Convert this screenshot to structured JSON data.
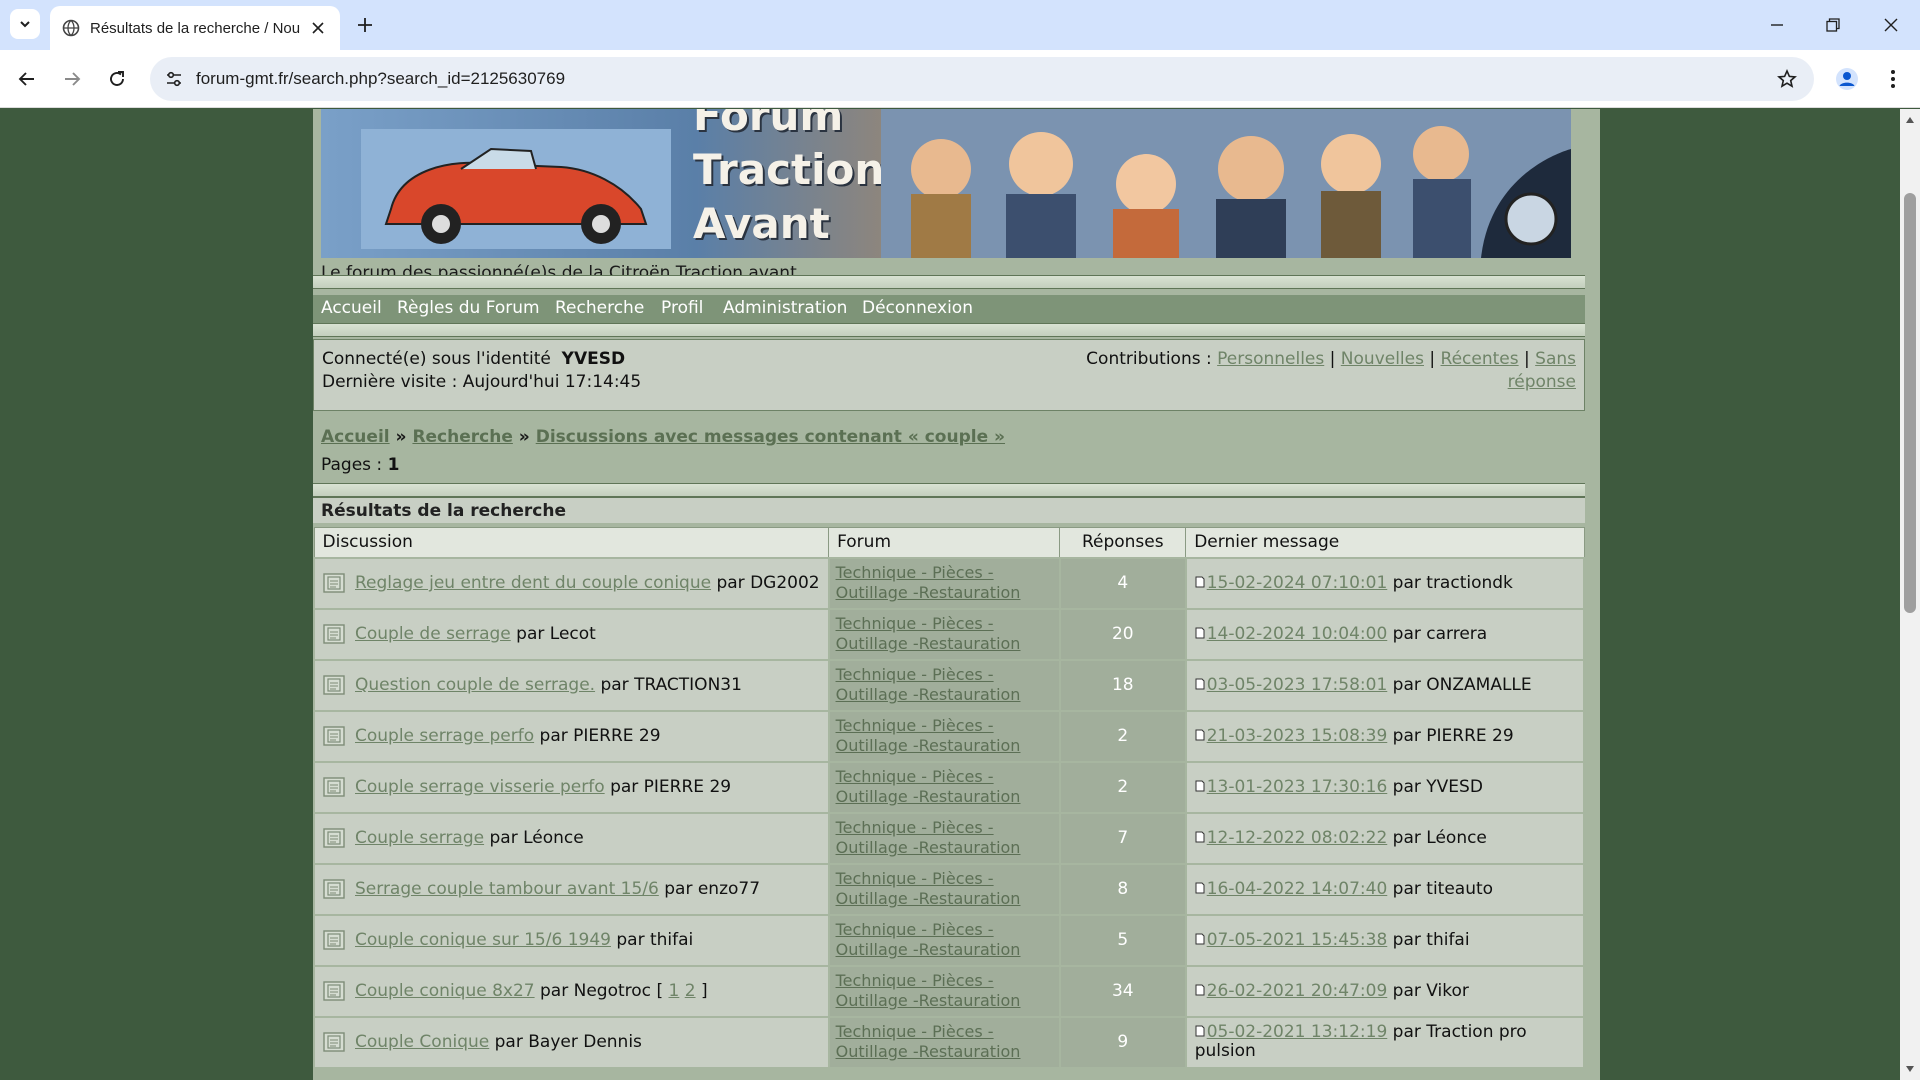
{
  "browser": {
    "tab_title": "Résultats de la recherche / Nou",
    "url": "forum-gmt.fr/search.php?search_id=2125630769"
  },
  "header": {
    "banner_line1": "Forum",
    "banner_line2": "Traction",
    "banner_line3": "Avant",
    "tagline": "Le forum des passionné(e)s de la Citroën Traction avant"
  },
  "menu": {
    "items": [
      "Accueil",
      "Règles du Forum",
      "Recherche",
      "Profil",
      "Administration",
      "Déconnexion"
    ]
  },
  "status": {
    "connected_prefix": "Connecté(e) sous l'identité",
    "username": "YVESD",
    "last_visit": "Dernière visite : Aujourd'hui 17:14:45",
    "contributions_label": "Contributions :",
    "link_personal": "Personnelles",
    "link_new": "Nouvelles",
    "link_recent": "Récentes",
    "link_unanswered_1": "Sans",
    "link_unanswered_2": "réponse",
    "sep": "|"
  },
  "breadcrumb": {
    "home": "Accueil",
    "sep": "»",
    "search": "Recherche",
    "current": "Discussions avec messages contenant « couple »"
  },
  "pagination": {
    "label": "Pages :",
    "current": "1"
  },
  "results": {
    "title": "Résultats de la recherche",
    "columns": [
      "Discussion",
      "Forum",
      "Réponses",
      "Dernier message"
    ],
    "par": "par",
    "forum_line1": "Technique - Pièces -",
    "forum_line2": "Outillage -Restauration",
    "rows": [
      {
        "topic": "Reglage jeu entre dent du couple conique",
        "author": "DG2002",
        "replies": "4",
        "last_date": "15-02-2024 07:10:01",
        "last_author": "tractiondk"
      },
      {
        "topic": "Couple de serrage",
        "author": "Lecot",
        "replies": "20",
        "last_date": "14-02-2024 10:04:00",
        "last_author": "carrera"
      },
      {
        "topic": "Question couple de serrage.",
        "author": "TRACTION31",
        "replies": "18",
        "last_date": "03-05-2023 17:58:01",
        "last_author": "ONZAMALLE"
      },
      {
        "topic": "Couple serrage perfo",
        "author": "PIERRE 29",
        "replies": "2",
        "last_date": "21-03-2023 15:08:39",
        "last_author": "PIERRE 29"
      },
      {
        "topic": "Couple serrage visserie perfo",
        "author": "PIERRE 29",
        "replies": "2",
        "last_date": "13-01-2023 17:30:16",
        "last_author": "YVESD"
      },
      {
        "topic": "Couple serrage",
        "author": "Léonce",
        "replies": "7",
        "last_date": "12-12-2022 08:02:22",
        "last_author": "Léonce"
      },
      {
        "topic": "Serrage couple tambour avant 15/6",
        "author": "enzo77",
        "replies": "8",
        "last_date": "16-04-2022 14:07:40",
        "last_author": "titeauto"
      },
      {
        "topic": "Couple conique sur 15/6 1949",
        "author": "thifai",
        "replies": "5",
        "last_date": "07-05-2021 15:45:38",
        "last_author": "thifai"
      },
      {
        "topic": "Couple conique 8x27",
        "author": "Negotroc",
        "pages": [
          "1",
          "2"
        ],
        "replies": "34",
        "last_date": "26-02-2021 20:47:09",
        "last_author": "Vikor"
      },
      {
        "topic": "Couple Conique",
        "author": "Bayer Dennis",
        "replies": "9",
        "last_date": "05-02-2021 13:12:19",
        "last_author": "Traction pro pulsion"
      }
    ]
  }
}
